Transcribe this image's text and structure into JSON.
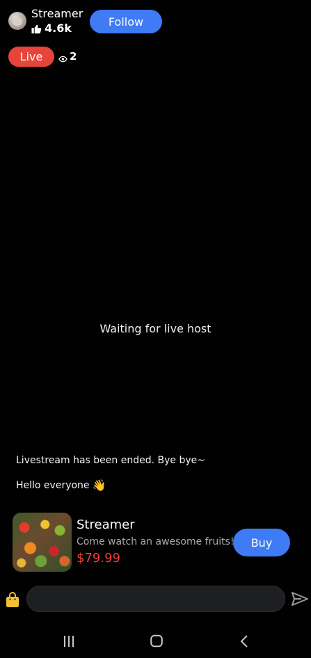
{
  "header": {
    "streamer_name": "Streamer",
    "likes": "4.6k",
    "follow_label": "Follow"
  },
  "status": {
    "live_label": "Live",
    "viewer_count": "2"
  },
  "stage": {
    "waiting_text": "Waiting for live host"
  },
  "chat": {
    "messages": [
      {
        "text": "Livestream has been ended. Bye bye~"
      },
      {
        "text": "Hello everyone",
        "emoji": "👋"
      }
    ]
  },
  "product": {
    "title": "Streamer",
    "description": "Come watch an awesome fruits!",
    "price": "$79.99",
    "buy_label": "Buy"
  },
  "input": {
    "value": "",
    "placeholder": ""
  },
  "colors": {
    "accent_blue": "#3f7bf5",
    "live_red": "#e5453b",
    "price_red": "#e8413a",
    "bag_yellow": "#f2c230"
  },
  "icons": [
    "thumbs-up-icon",
    "eye-icon",
    "shopping-bag-icon",
    "send-icon",
    "nav-recent-icon",
    "nav-home-icon",
    "nav-back-icon"
  ]
}
